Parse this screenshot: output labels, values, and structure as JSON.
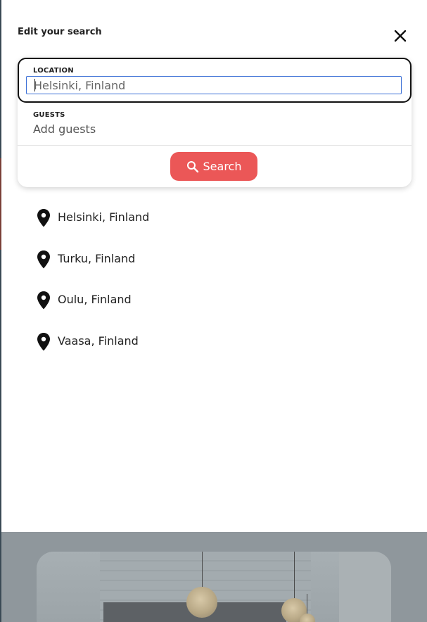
{
  "modal": {
    "title": "Edit your search",
    "close_icon": "close-icon"
  },
  "search": {
    "location_label": "LOCATION",
    "location_value": "",
    "location_placeholder": "Helsinki, Finland",
    "guests_label": "GUESTS",
    "guests_placeholder": "Add guests",
    "button_label": "Search",
    "button_icon": "search-icon",
    "button_color": "#eb5757",
    "focus_border_color": "#3b6fd6"
  },
  "suggestions": [
    {
      "label": "Helsinki, Finland",
      "icon": "location-pin-icon"
    },
    {
      "label": "Turku, Finland",
      "icon": "location-pin-icon"
    },
    {
      "label": "Oulu, Finland",
      "icon": "location-pin-icon"
    },
    {
      "label": "Vaasa, Finland",
      "icon": "location-pin-icon"
    }
  ],
  "background": {
    "overlay_color": "#8f979c",
    "image": "room-photo-with-pendant-lights"
  }
}
